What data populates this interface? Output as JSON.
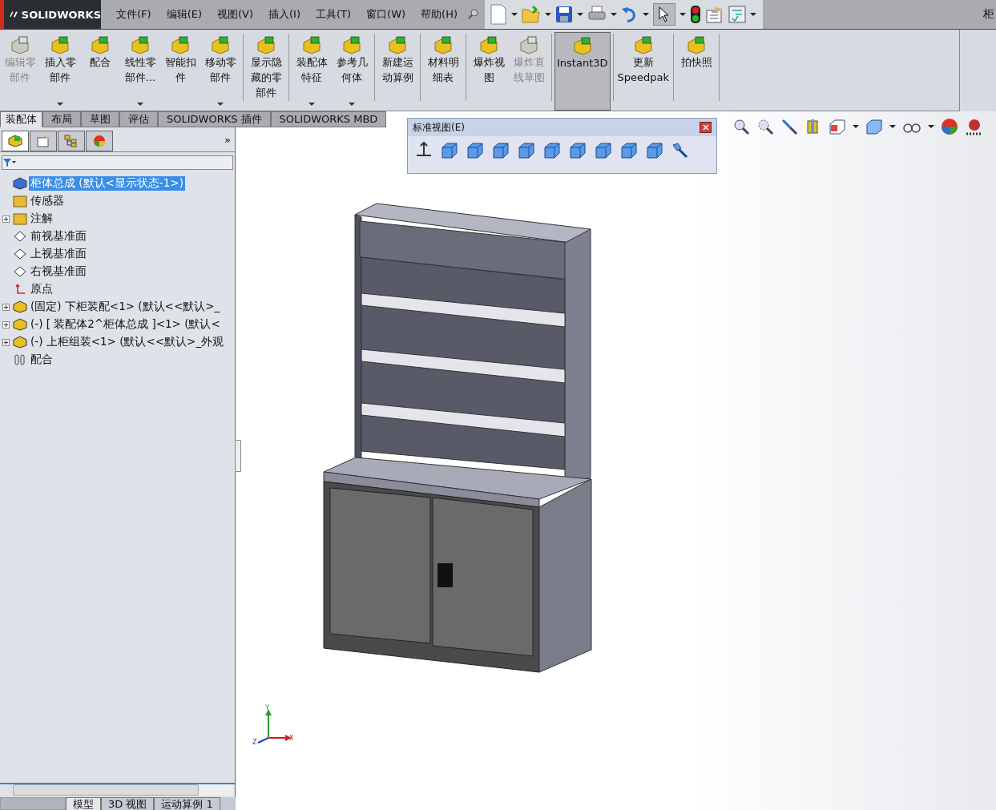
{
  "app": {
    "logo": "SOLIDWORKS",
    "menus": [
      "文件(F)",
      "编辑(E)",
      "视图(V)",
      "插入(I)",
      "工具(T)",
      "窗口(W)",
      "帮助(H)"
    ],
    "title_fragment": "柜"
  },
  "ribbon": {
    "groups": [
      [
        {
          "label": "编辑零部件",
          "disabled": true,
          "dropdown": false,
          "selected": false
        },
        {
          "label": "插入零部件",
          "disabled": false,
          "dropdown": true,
          "selected": false
        },
        {
          "label": "配合",
          "disabled": false,
          "dropdown": false,
          "selected": false
        },
        {
          "label": "线性零部件...",
          "disabled": false,
          "dropdown": true,
          "selected": false
        },
        {
          "label": "智能扣件",
          "disabled": false,
          "dropdown": false,
          "selected": false
        },
        {
          "label": "移动零部件",
          "disabled": false,
          "dropdown": true,
          "selected": false
        }
      ],
      [
        {
          "label": "显示隐藏的零部件",
          "disabled": false,
          "dropdown": false,
          "selected": false
        }
      ],
      [
        {
          "label": "装配体特征",
          "disabled": false,
          "dropdown": true,
          "selected": false
        },
        {
          "label": "参考几何体",
          "disabled": false,
          "dropdown": true,
          "selected": false
        }
      ],
      [
        {
          "label": "新建运动算例",
          "disabled": false,
          "dropdown": false,
          "selected": false
        }
      ],
      [
        {
          "label": "材料明细表",
          "disabled": false,
          "dropdown": false,
          "selected": false
        }
      ],
      [
        {
          "label": "爆炸视图",
          "disabled": false,
          "dropdown": false,
          "selected": false
        },
        {
          "label": "爆炸直线草图",
          "disabled": true,
          "dropdown": false,
          "selected": false
        }
      ],
      [
        {
          "label": "Instant3D",
          "disabled": false,
          "dropdown": false,
          "selected": true
        }
      ],
      [
        {
          "label": "更新 Speedpak",
          "disabled": false,
          "dropdown": false,
          "selected": false
        }
      ],
      [
        {
          "label": "拍快照",
          "disabled": false,
          "dropdown": false,
          "selected": false
        }
      ]
    ]
  },
  "command_tabs": [
    {
      "label": "装配体",
      "selected": true
    },
    {
      "label": "布局",
      "selected": false
    },
    {
      "label": "草图",
      "selected": false
    },
    {
      "label": "评估",
      "selected": false
    },
    {
      "label": "SOLIDWORKS 插件",
      "selected": false
    },
    {
      "label": "SOLIDWORKS MBD",
      "selected": false
    }
  ],
  "tree": {
    "expand_label": "»",
    "items": [
      {
        "label": "柜体总成  (默认<显示状态-1>)",
        "kind": "assembly",
        "expandable": false,
        "selected": true
      },
      {
        "label": "传感器",
        "kind": "sensor",
        "expandable": false,
        "selected": false
      },
      {
        "label": "注解",
        "kind": "annotation",
        "expandable": true,
        "selected": false
      },
      {
        "label": "前视基准面",
        "kind": "plane",
        "expandable": false,
        "selected": false
      },
      {
        "label": "上视基准面",
        "kind": "plane",
        "expandable": false,
        "selected": false
      },
      {
        "label": "右视基准面",
        "kind": "plane",
        "expandable": false,
        "selected": false
      },
      {
        "label": "原点",
        "kind": "origin",
        "expandable": false,
        "selected": false
      },
      {
        "label": "(固定) 下柜装配<1> (默认<<默认>_",
        "kind": "component",
        "expandable": true,
        "selected": false
      },
      {
        "label": "(-) [ 装配体2^柜体总成 ]<1> (默认<",
        "kind": "component",
        "expandable": true,
        "selected": false
      },
      {
        "label": "(-) 上柜组装<1> (默认<<默认>_外观",
        "kind": "component",
        "expandable": true,
        "selected": false
      },
      {
        "label": "配合",
        "kind": "mates",
        "expandable": false,
        "selected": false
      }
    ]
  },
  "std_views": {
    "title": "标准视图(E)"
  },
  "triad": {
    "x": "X",
    "y": "Y",
    "z": "Z"
  },
  "bottom_tabs": [
    {
      "label": "模型",
      "selected": true
    },
    {
      "label": "3D 视图",
      "selected": false
    },
    {
      "label": "运动算例 1",
      "selected": false
    }
  ]
}
